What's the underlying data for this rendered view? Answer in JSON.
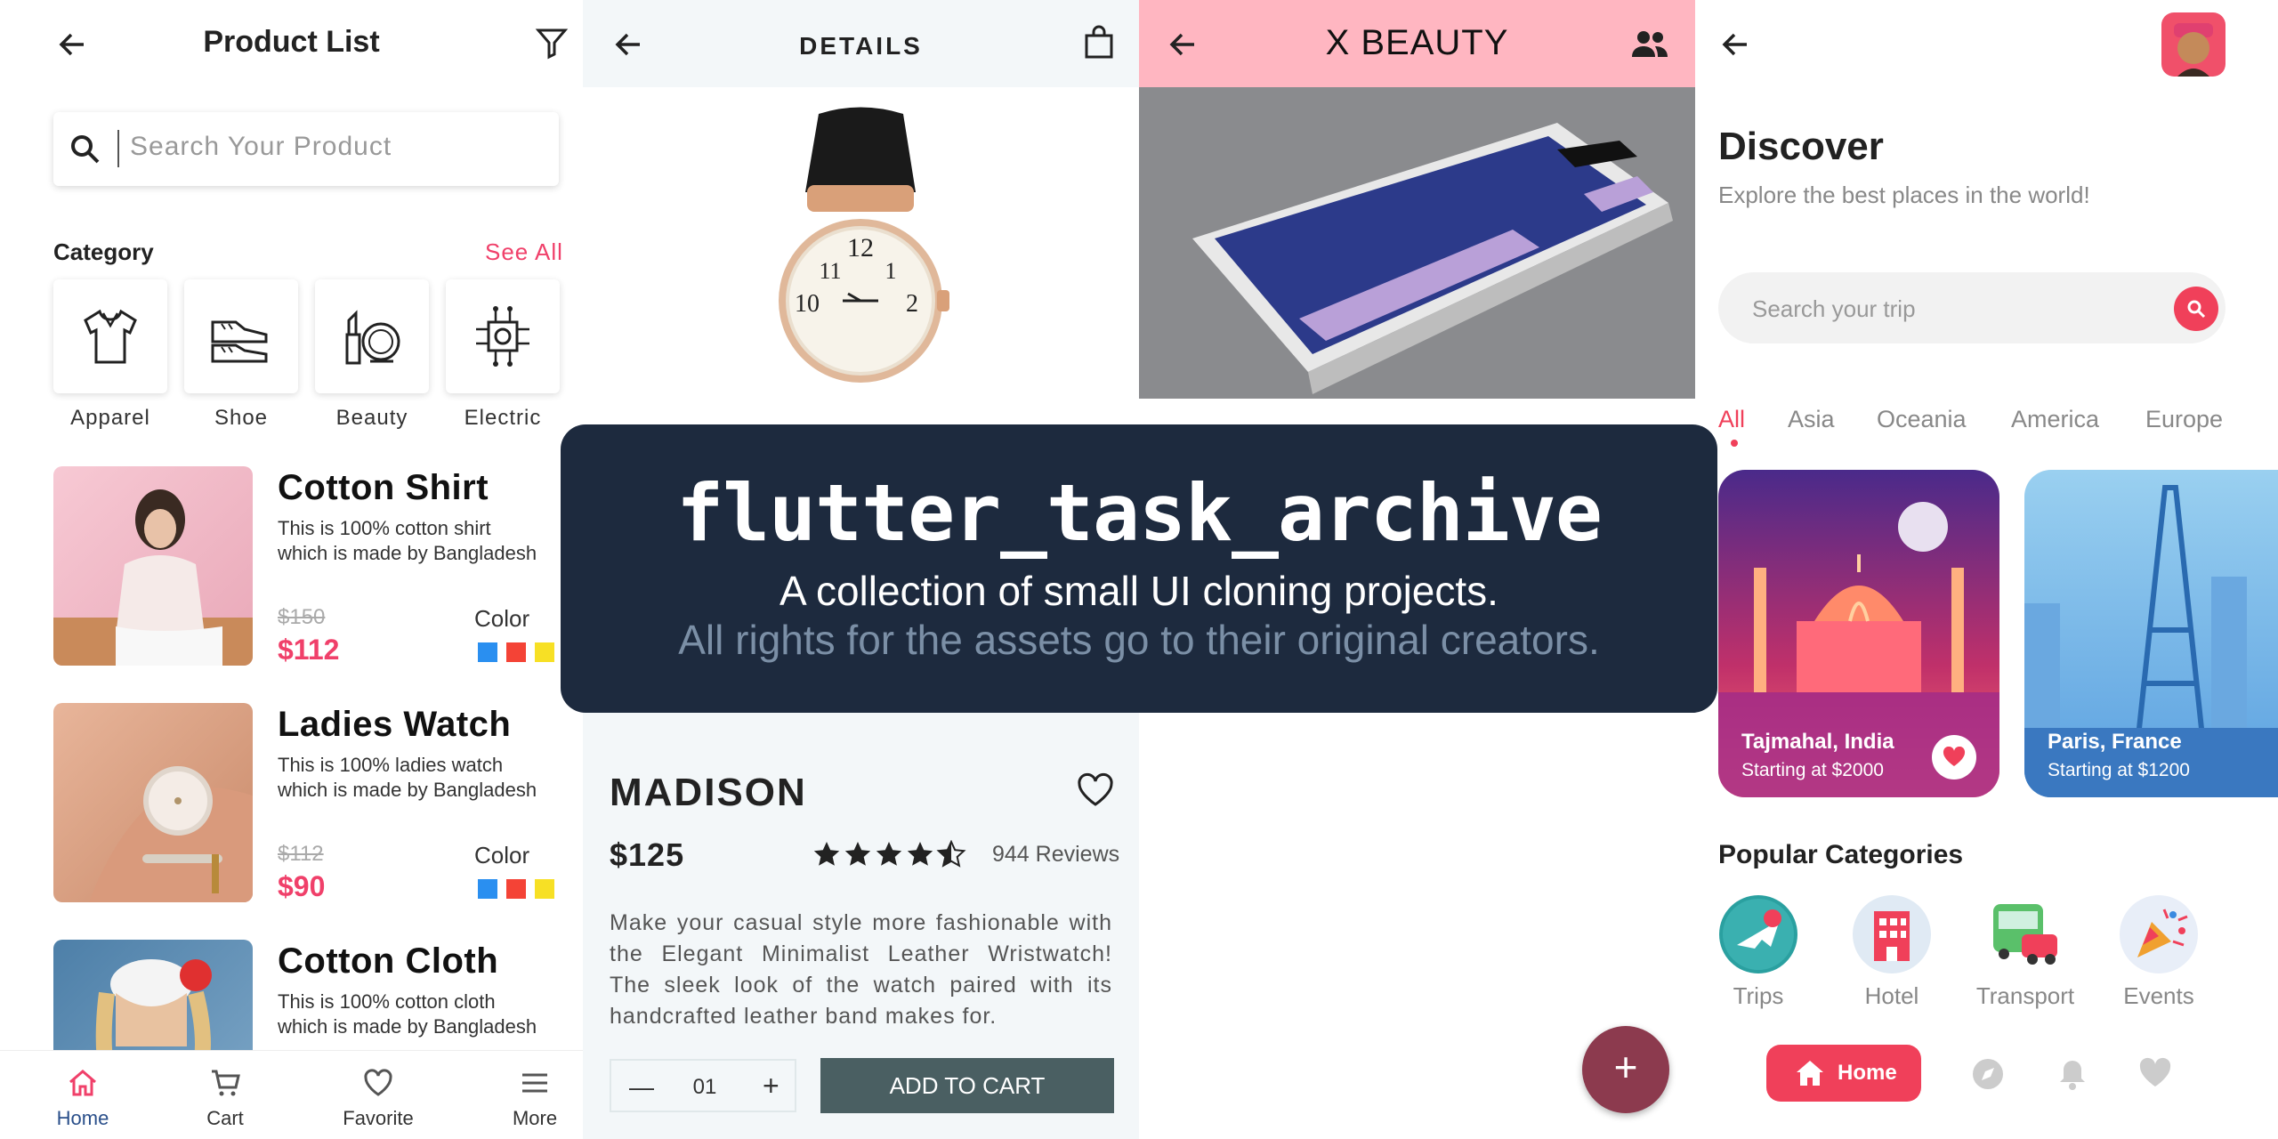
{
  "product_list": {
    "title": "Product List",
    "search_placeholder": "Search Your Product",
    "category_heading": "Category",
    "see_all": "See All",
    "categories": [
      {
        "label": "Apparel",
        "icon": "shirt-icon"
      },
      {
        "label": "Shoe",
        "icon": "shoe-icon"
      },
      {
        "label": "Beauty",
        "icon": "beauty-icon"
      },
      {
        "label": "Electric",
        "icon": "chip-icon"
      }
    ],
    "products": [
      {
        "name": "Cotton Shirt",
        "desc": "This is 100% cotton shirt which is made by Bangladesh",
        "old_price": "$150",
        "price": "$112",
        "color_label": "Color"
      },
      {
        "name": "Ladies Watch",
        "desc": "This is 100% ladies watch which is made by Bangladesh",
        "old_price": "$112",
        "price": "$90",
        "color_label": "Color"
      },
      {
        "name": "Cotton Cloth",
        "desc": "This is 100% cotton cloth which is made by Bangladesh"
      }
    ],
    "swatch_colors": [
      "#2a8ff0",
      "#f44336",
      "#f7e025"
    ],
    "nav": [
      {
        "label": "Home",
        "icon": "home-icon"
      },
      {
        "label": "Cart",
        "icon": "cart-icon"
      },
      {
        "label": "Favorite",
        "icon": "heart-icon"
      },
      {
        "label": "More",
        "icon": "menu-icon"
      }
    ]
  },
  "details": {
    "title": "DETAILS",
    "name": "MADISON",
    "price": "$125",
    "rating": 4.5,
    "reviews": "944 Reviews",
    "description": "Make your casual style more fashionable with the Elegant Minimalist Leather Wristwatch! The sleek look of the watch paired with its handcrafted leather band makes for.",
    "quantity": "01",
    "add_to_cart": "ADD TO CART"
  },
  "xbeauty": {
    "title": "X BEAUTY",
    "fab": "+"
  },
  "discover": {
    "title": "Discover",
    "subtitle": "Explore the best places in the world!",
    "search_placeholder": "Search your trip",
    "tabs": [
      "All",
      "Asia",
      "Oceania",
      "America",
      "Europe"
    ],
    "destinations": [
      {
        "name": "Tajmahal, India",
        "price": "Starting at $2000"
      },
      {
        "name": "Paris, France",
        "price": "Starting at $1200"
      }
    ],
    "popular_heading": "Popular Categories",
    "popular": [
      "Trips",
      "Hotel",
      "Transport",
      "Events"
    ],
    "home_label": "Home",
    "accent": "#f0405a"
  },
  "overlay": {
    "title": "flutter_task_archive",
    "subtitle": "A collection of small UI cloning projects.",
    "rights": "All rights for the assets go to their original creators."
  }
}
